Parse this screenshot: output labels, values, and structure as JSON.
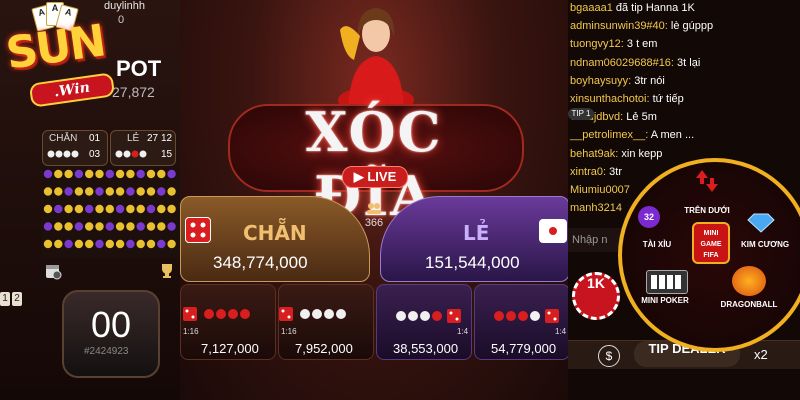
{
  "header": {
    "username": "duylinhh",
    "user_value": "0",
    "logo_main": "SUN",
    "logo_sub": ".Win"
  },
  "jackpot": {
    "label": "POT",
    "value": "27,872"
  },
  "stats": {
    "chan_label": "CHẴN",
    "chan_count_top": "01",
    "chan_count_bottom": "03",
    "le_label": "LẺ",
    "le_count": "27",
    "le_count_top": "12",
    "le_count_bottom": "15"
  },
  "timer": {
    "value": "00",
    "session": "#2424923"
  },
  "pager": {
    "p1": "1",
    "p2": "2"
  },
  "game": {
    "title": "XÓC ĐĨA",
    "live_label": "LIVE",
    "viewers": "366"
  },
  "bets": {
    "chan": {
      "label": "CHẴN",
      "amount": "348,774,000"
    },
    "le": {
      "label": "LẺ",
      "amount": "151,544,000"
    },
    "sub": [
      {
        "odds": "1:16",
        "amount": "7,127,000"
      },
      {
        "odds": "1:16",
        "amount": "7,952,000"
      },
      {
        "odds": "1:4",
        "amount": "38,553,000"
      },
      {
        "odds": "1:4",
        "amount": "54,779,000"
      }
    ]
  },
  "chat": {
    "messages": [
      {
        "name": "bgaaaa1",
        "msg": "đã tip Hanna 1K"
      },
      {
        "name": "adminsunwin39#40:",
        "msg": "lè gúppp"
      },
      {
        "name": "tuongvy12:",
        "msg": "3 t em"
      },
      {
        "name": "ndnam06029688#16:",
        "msg": "3t lại"
      },
      {
        "name": "boyhaysuyy:",
        "msg": "3tr nói"
      },
      {
        "name": "xinsunthachotoi:",
        "msg": "tứ tiếp"
      },
      {
        "name": "vdhdjdbvd:",
        "msg": "Lẻ 5m"
      },
      {
        "name": "__petrolimex__:",
        "msg": "A men ..."
      },
      {
        "name": "behat9ak:",
        "msg": "xin kepp"
      },
      {
        "name": "xintra0:",
        "msg": "3tr"
      },
      {
        "name": "Miumiu0007",
        "msg": ""
      },
      {
        "name": "manh3214",
        "msg": ""
      }
    ],
    "tip_badge": "TIP 1",
    "input_placeholder": "Nhập n",
    "tip_dealer": "TIP DEALER",
    "multiplier": "x2",
    "chip_value": "1K"
  },
  "mini_games": {
    "tren_duoi": "TRÊN DƯỚI",
    "tai_xiu": "TÀI XỈU",
    "tai_xiu_badge": "32",
    "kim_cuong": "KIM CƯƠNG",
    "center_line1": "MINI",
    "center_line2": "GAME",
    "center_line3": "FIFA",
    "mini_poker": "MINI POKER",
    "dragonball": "DRAGONBALL"
  },
  "colors": {
    "chat_name": "#f2c94c",
    "chan_gold": "#f0c070",
    "le_purple": "#c8b0ff",
    "live_red": "#c81e1e",
    "ring_gold": "#f0b020"
  }
}
